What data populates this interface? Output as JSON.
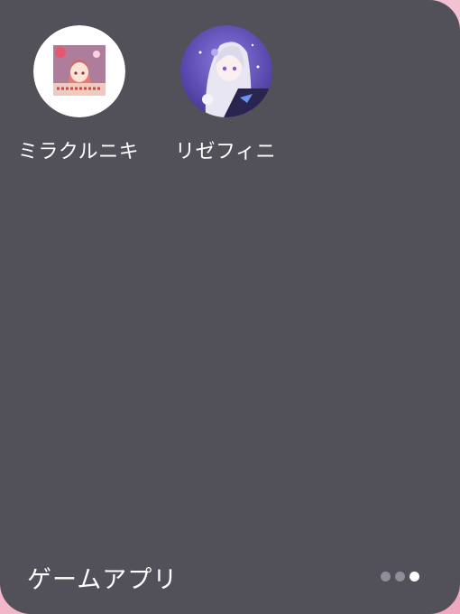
{
  "folder": {
    "title": "ゲームアプリ",
    "apps": [
      {
        "label": "ミラクルニキ",
        "icon": "miracle-nikki-app-icon"
      },
      {
        "label": "リゼフィニ",
        "icon": "rezero-infinity-app-icon"
      }
    ],
    "pages": {
      "total": 3,
      "current": 3
    }
  },
  "colors": {
    "folder_background": "#525059",
    "text": "#ffffff",
    "dot_inactive": "#8f8d99",
    "dot_active": "#ffffff"
  }
}
